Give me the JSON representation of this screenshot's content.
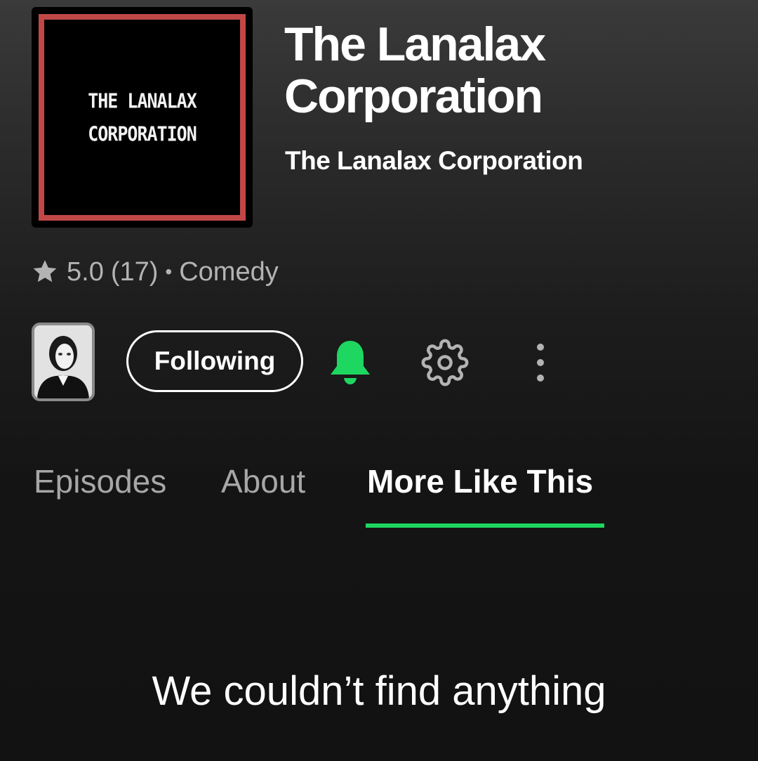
{
  "show": {
    "cover_lines": [
      "THE LANALAX",
      "CORPORATION"
    ],
    "title": "The Lanalax Corporation",
    "author": "The Lanalax Corporation",
    "rating": "5.0",
    "rating_count": "(17)",
    "separator": "•",
    "category": "Comedy"
  },
  "actions": {
    "follow_label": "Following",
    "notifications_on": true
  },
  "tabs": [
    {
      "label": "Episodes",
      "active": false
    },
    {
      "label": "About",
      "active": false
    },
    {
      "label": "More Like This",
      "active": true
    }
  ],
  "empty_state": {
    "message": "We couldn’t find anything"
  },
  "colors": {
    "accent": "#1ed760",
    "cover_border": "#c14747",
    "muted_text": "#b3b3b3"
  },
  "icons": [
    "star-icon",
    "bell-icon",
    "gear-icon",
    "more-vertical-icon"
  ]
}
